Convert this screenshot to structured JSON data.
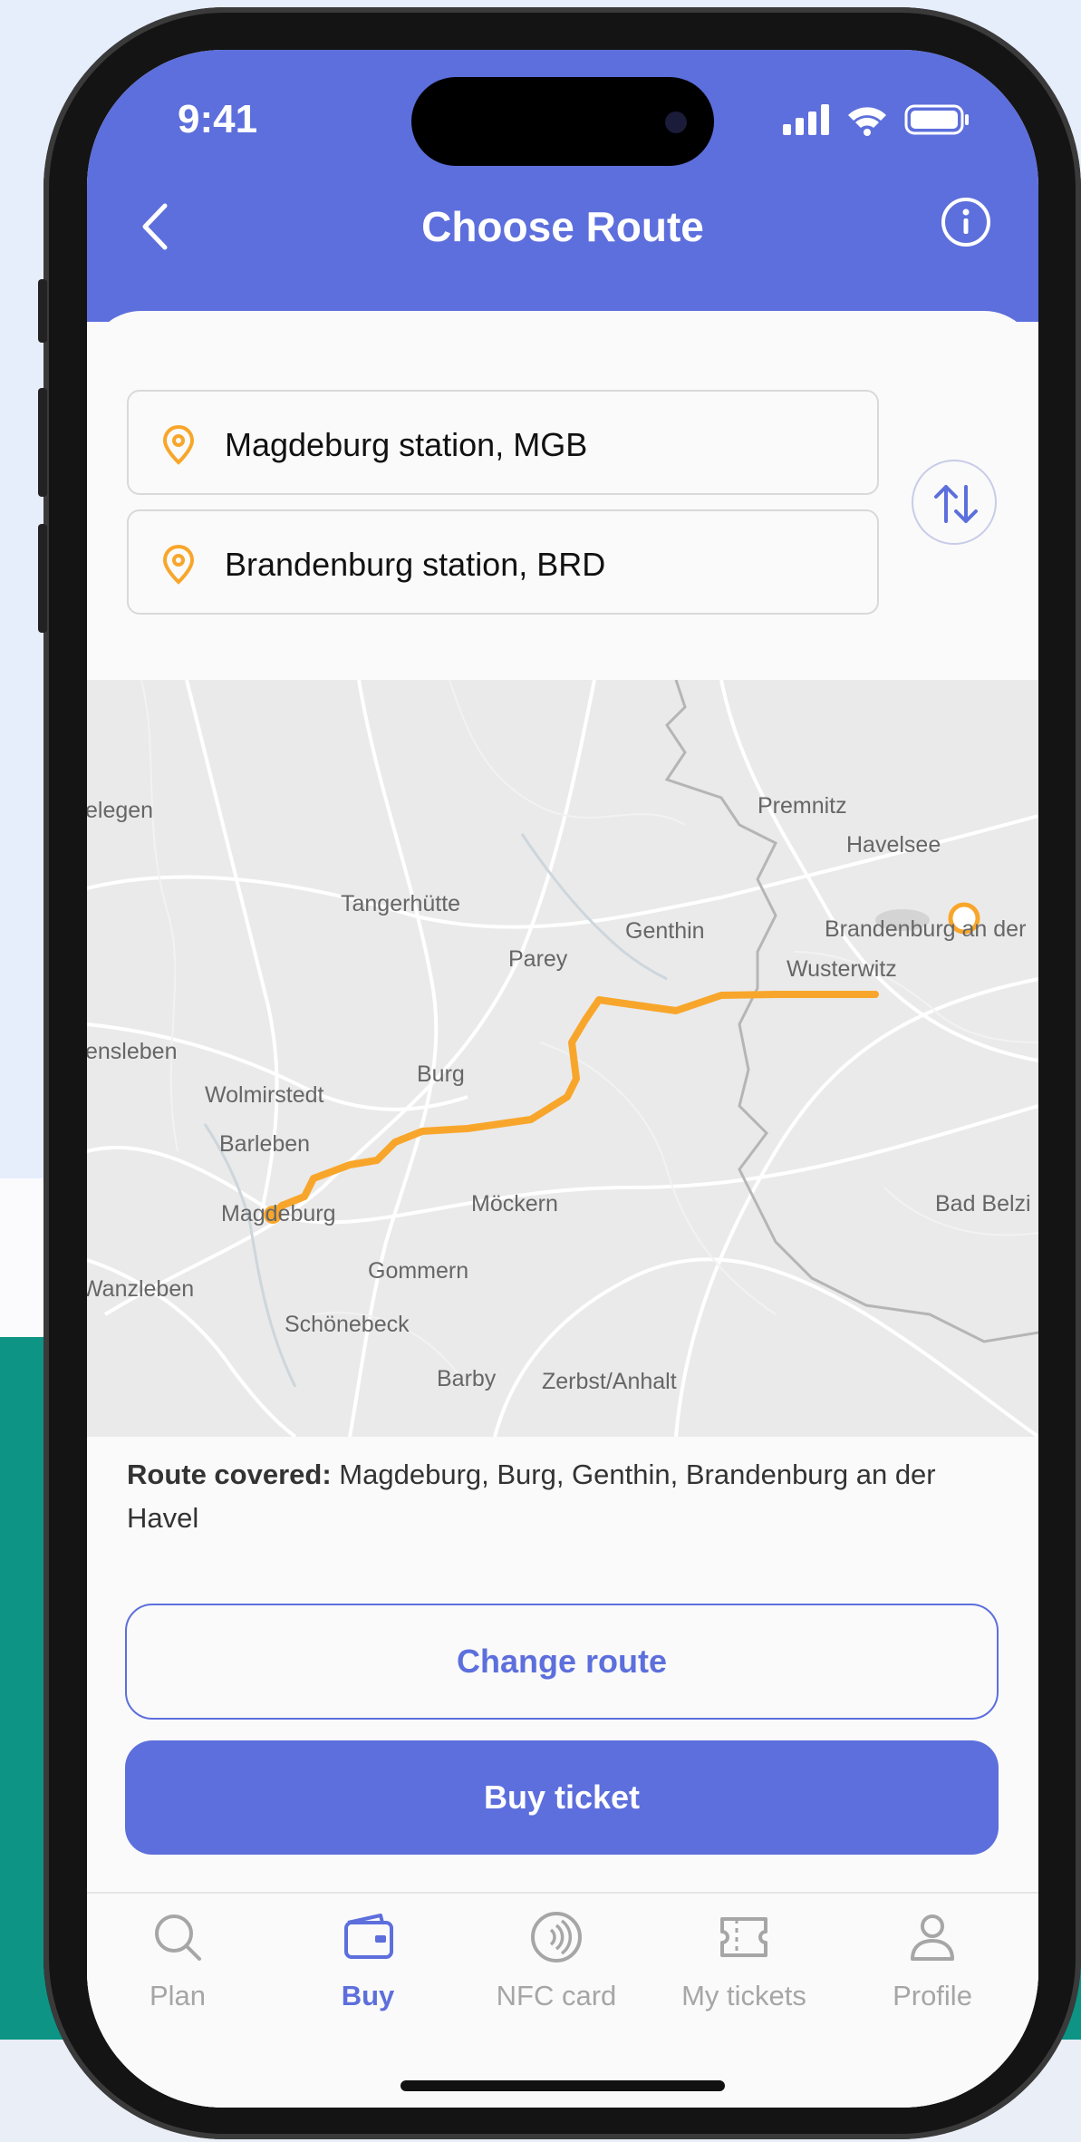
{
  "status_bar": {
    "time": "9:41"
  },
  "header": {
    "title": "Choose Route"
  },
  "route_fields": {
    "from": "Magdeburg station, MGB",
    "to": "Brandenburg station, BRD"
  },
  "map": {
    "labels": {
      "elegen": "elegen",
      "tangerhuette": "Tangerhütte",
      "premnitz": "Premnitz",
      "havelsee": "Havelsee",
      "parey": "Parey",
      "genthin": "Genthin",
      "brandenburg": "Brandenburg an der",
      "wusterwitz": "Wusterwitz",
      "ensleben": "ensleben",
      "wolmirstedt": "Wolmirstedt",
      "burg": "Burg",
      "barleben": "Barleben",
      "magdeburg": "Magdeburg",
      "moeckern": "Möckern",
      "bad_belzig": "Bad Belzi",
      "wanzleben": "Wanzleben",
      "gommern": "Gommern",
      "schoenebeck": "Schönebeck",
      "barby": "Barby",
      "zerbst": "Zerbst/Anhalt"
    },
    "route_color": "#f8a62b"
  },
  "route_info": {
    "label": "Route covered:",
    "value": "Magdeburg, Burg, Genthin, Brandenburg an der Havel"
  },
  "buttons": {
    "change_route": "Change route",
    "buy_ticket": "Buy ticket"
  },
  "tabs": [
    {
      "label": "Plan",
      "icon": "search-icon",
      "active": false
    },
    {
      "label": "Buy",
      "icon": "wallet-icon",
      "active": true
    },
    {
      "label": "NFC card",
      "icon": "nfc-icon",
      "active": false
    },
    {
      "label": "My tickets",
      "icon": "ticket-icon",
      "active": false
    },
    {
      "label": "Profile",
      "icon": "profile-icon",
      "active": false
    }
  ],
  "colors": {
    "accent": "#5d6fdc",
    "pin": "#f8a62b",
    "background_teal": "#0d9485"
  }
}
